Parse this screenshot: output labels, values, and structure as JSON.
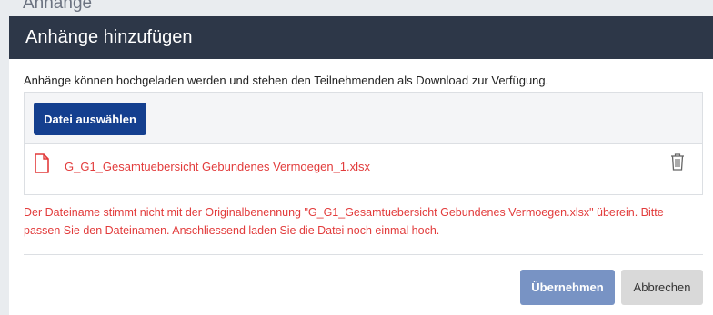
{
  "background": {
    "text_fragment": "Anhänge"
  },
  "modal": {
    "title": "Anhänge hinzufügen",
    "intro": "Anhänge können hochgeladen werden und stehen den Teilnehmenden als Download zur Verfügung.",
    "choose_button": "Datei auswählen",
    "file": {
      "name": "G_G1_Gesamtuebersicht Gebundenes Vermoegen_1.xlsx",
      "icon": "file-icon"
    },
    "delete_icon": "trash-icon",
    "error": "Der Dateiname stimmt nicht mit der Originalbenennung \"G_G1_Gesamtuebersicht Gebundenes Vermoegen.xlsx\" überein. Bitte passen Sie den Dateinamen. Anschliessend laden Sie die Datei noch einmal hoch.",
    "confirm_button": "Übernehmen",
    "cancel_button": "Abbrechen"
  },
  "colors": {
    "header_bg": "#2d3748",
    "primary": "#143f8f",
    "primary_disabled": "#7893c4",
    "error": "#e23b3b"
  }
}
